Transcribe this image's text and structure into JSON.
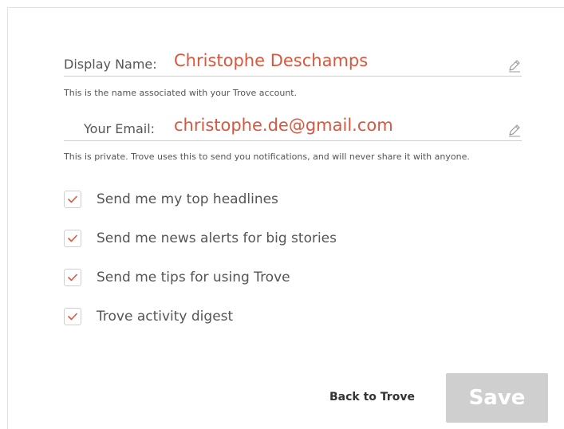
{
  "profile": {
    "display_name": {
      "label": "Display Name:",
      "value": "Christophe Deschamps",
      "help": "This is the name associated with your Trove account."
    },
    "email": {
      "label": "Your Email:",
      "value": "christophe.de@gmail.com",
      "help": "This is private. Trove uses this to send you notifications, and will never share it with anyone."
    }
  },
  "preferences": [
    {
      "label": "Send me my top headlines",
      "checked": true
    },
    {
      "label": "Send me news alerts for big stories",
      "checked": true
    },
    {
      "label": "Send me tips for using Trove",
      "checked": true
    },
    {
      "label": "Trove activity digest",
      "checked": true
    }
  ],
  "actions": {
    "back_label": "Back to Trove",
    "save_label": "Save"
  },
  "icons": {
    "edit": "pencil-icon",
    "check": "checkmark-icon"
  },
  "colors": {
    "accent": "#d9573f",
    "text": "#555555",
    "save_disabled": "#cfcfcf"
  }
}
